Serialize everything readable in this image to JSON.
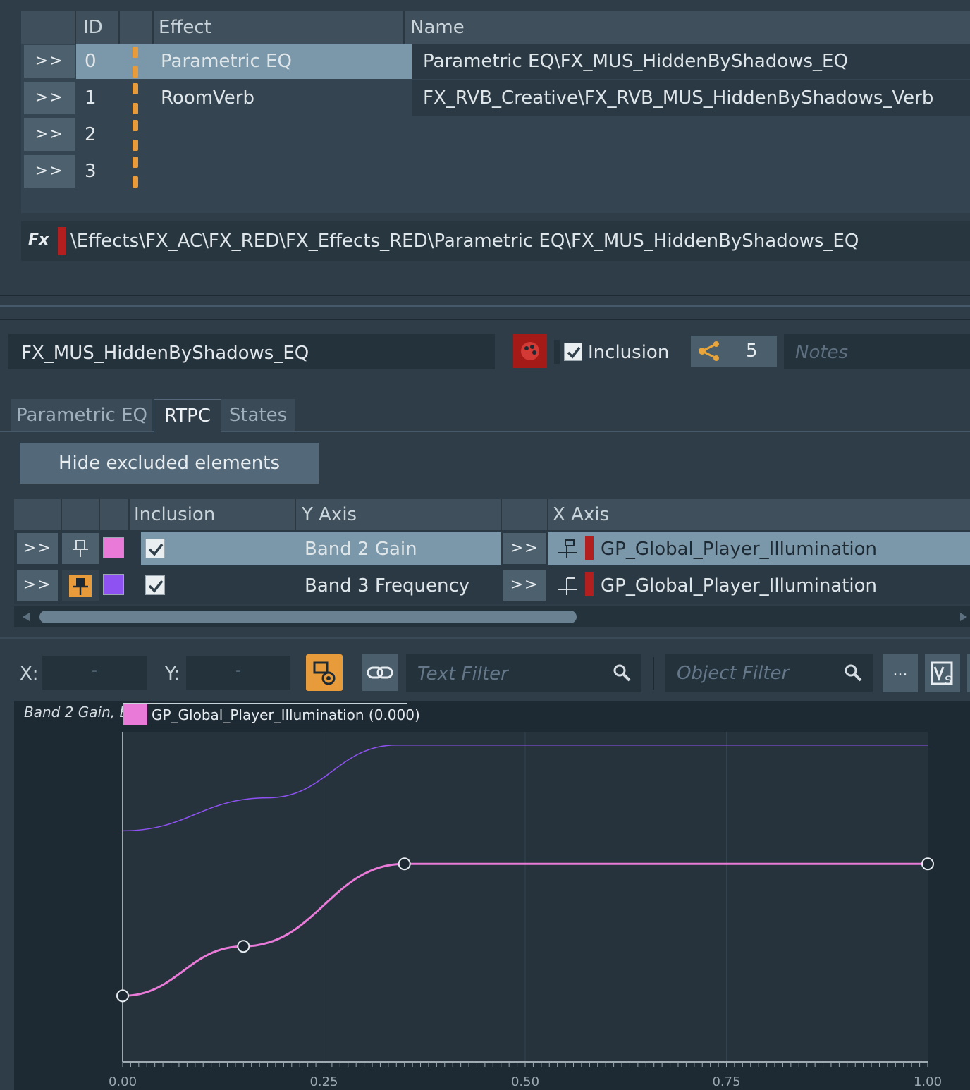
{
  "effects_table": {
    "headers": {
      "id": "ID",
      "effect": "Effect",
      "name": "Name"
    },
    "rows": [
      {
        "expand": ">>",
        "id": "0",
        "effect": "Parametric EQ",
        "name": "Parametric EQ\\FX_MUS_HiddenByShadows_EQ"
      },
      {
        "expand": ">>",
        "id": "1",
        "effect": "RoomVerb",
        "name": "FX_RVB_Creative\\FX_RVB_MUS_HiddenByShadows_Verb"
      },
      {
        "expand": ">>",
        "id": "2",
        "effect": "",
        "name": ""
      },
      {
        "expand": ">>",
        "id": "3",
        "effect": "",
        "name": ""
      }
    ],
    "path": "\\Effects\\FX_AC\\FX_RED\\FX_Effects_RED\\Parametric EQ\\FX_MUS_HiddenByShadows_EQ"
  },
  "object": {
    "name": "FX_MUS_HiddenByShadows_EQ",
    "inclusion_label": "Inclusion",
    "inclusion_checked": true,
    "references_count": "5",
    "notes_placeholder": "Notes"
  },
  "tabs": [
    {
      "label": "Parametric EQ",
      "active": false
    },
    {
      "label": "RTPC",
      "active": true
    },
    {
      "label": "States",
      "active": false
    }
  ],
  "hide_excluded_button": "Hide excluded elements",
  "rtpc_table": {
    "headers": {
      "inclusion": "Inclusion",
      "y_axis": "Y Axis",
      "x_axis": "X Axis"
    },
    "rows": [
      {
        "expand": ">>",
        "color": "#e97ad8",
        "included": true,
        "y_axis": "Band 2 Gain",
        "x_expand": ">>",
        "x_axis": "GP_Global_Player_Illumination",
        "selected": true
      },
      {
        "expand": ">>",
        "color": "#8f52f2",
        "included": true,
        "y_axis": "Band 3 Frequency",
        "x_expand": ">>",
        "x_axis": "GP_Global_Player_Illumination",
        "selected": false
      }
    ]
  },
  "graph_toolbar": {
    "x_label": "X:",
    "x_value": "-",
    "y_label": "Y:",
    "y_value": "-",
    "text_filter_placeholder": "Text Filter",
    "object_filter_placeholder": "Object Filter",
    "more_button": "..."
  },
  "graph": {
    "series_label": "Band 2 Gain, B",
    "legend": "GP_Global_Player_Illumination (0.000)",
    "x_ticks": [
      "0.00",
      "0.25",
      "0.50",
      "0.75",
      "1.00"
    ]
  },
  "chart_data": {
    "type": "line",
    "xlim": [
      0,
      1
    ],
    "ylim": [
      0,
      1
    ],
    "series": [
      {
        "name": "Band 2 Gain",
        "color": "#e97ad8",
        "points": [
          [
            0.0,
            0.2
          ],
          [
            0.15,
            0.35
          ],
          [
            0.35,
            0.6
          ],
          [
            1.0,
            0.6
          ]
        ],
        "show_points": true
      },
      {
        "name": "Band 3 Frequency",
        "color": "#8f52f2",
        "points": [
          [
            0.0,
            0.7
          ],
          [
            0.18,
            0.8
          ],
          [
            0.34,
            0.96
          ],
          [
            1.0,
            0.96
          ]
        ],
        "show_points": false
      }
    ],
    "grid": true
  }
}
